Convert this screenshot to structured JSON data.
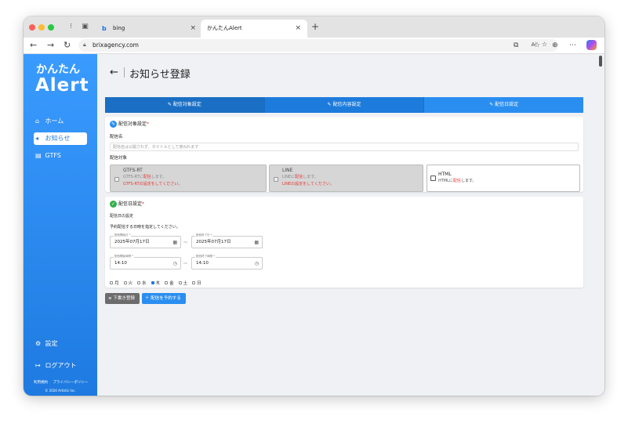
{
  "browser": {
    "tabs": [
      {
        "label": "bing",
        "favicon": "bing-icon",
        "close": "×"
      },
      {
        "label": "かんたんAlert",
        "favicon": "",
        "close": "×"
      }
    ],
    "new_tab": "+",
    "url": "brixagency.com",
    "read_aloud": "A⁾",
    "nav_back": "←",
    "nav_forward": "→",
    "nav_reload": "↻"
  },
  "sidebar": {
    "logo_line1": "かんたん",
    "logo_line2": "Alert",
    "items": [
      {
        "label": "ホーム",
        "icon": "home-icon"
      },
      {
        "label": "お知らせ",
        "icon": "megaphone-icon",
        "active": true
      },
      {
        "label": "GTFS",
        "icon": "document-icon"
      }
    ],
    "bottom_items": [
      {
        "label": "設定",
        "icon": "gear-icon"
      },
      {
        "label": "ログアウト",
        "icon": "logout-icon"
      }
    ],
    "links": [
      "利用規約",
      "プライバシーポリシー"
    ],
    "copyright": "© 2024 Artistic Inc."
  },
  "page": {
    "title": "お知らせ登録",
    "back": "←",
    "steps": [
      {
        "label": "配信対象設定"
      },
      {
        "label": "配信内容設定"
      },
      {
        "label": "配信日設定"
      }
    ]
  },
  "target_section": {
    "title": "配信対象設定",
    "required_mark": "*",
    "name_label": "配信名",
    "name_placeholder": "配信名は公開されず、タイトルとして使われます",
    "target_label": "配信対象",
    "options": [
      {
        "title": "GTFS-RT",
        "desc_prefix": "GTFS-RTに",
        "desc_red": "配信",
        "desc_suffix": "します。",
        "warning": "GTFS-RTの設定をしてください。",
        "enabled": false
      },
      {
        "title": "LINE",
        "desc_prefix": "LINEに",
        "desc_red": "配信",
        "desc_suffix": "します。",
        "warning": "LINEの設定をしてください。",
        "enabled": false
      },
      {
        "title": "HTML",
        "desc_prefix": "HTMLに",
        "desc_red": "配信",
        "desc_suffix": "します。",
        "warning": "",
        "enabled": true
      }
    ]
  },
  "date_section": {
    "title": "配信日設定",
    "required_mark": "*",
    "subtitle": "配信日の設定",
    "instruction": "予約配信する日時を指定してください。",
    "start_date": {
      "label": "配信開始日 *",
      "value": "2025年07月17日"
    },
    "end_date": {
      "label": "配信終了日 *",
      "value": "2025年07月17日"
    },
    "start_time": {
      "label": "配信開始時間 *",
      "value": "14:10"
    },
    "end_time": {
      "label": "配信終了時間 *",
      "value": "14:10"
    },
    "separator": "〜",
    "weekdays": [
      {
        "label": "月",
        "checked": false
      },
      {
        "label": "火",
        "checked": false
      },
      {
        "label": "水",
        "checked": false
      },
      {
        "label": "木",
        "checked": true
      },
      {
        "label": "金",
        "checked": false
      },
      {
        "label": "土",
        "checked": false
      },
      {
        "label": "日",
        "checked": false
      }
    ]
  },
  "actions": {
    "draft": "下書き登録",
    "schedule": "配信を予約する"
  }
}
